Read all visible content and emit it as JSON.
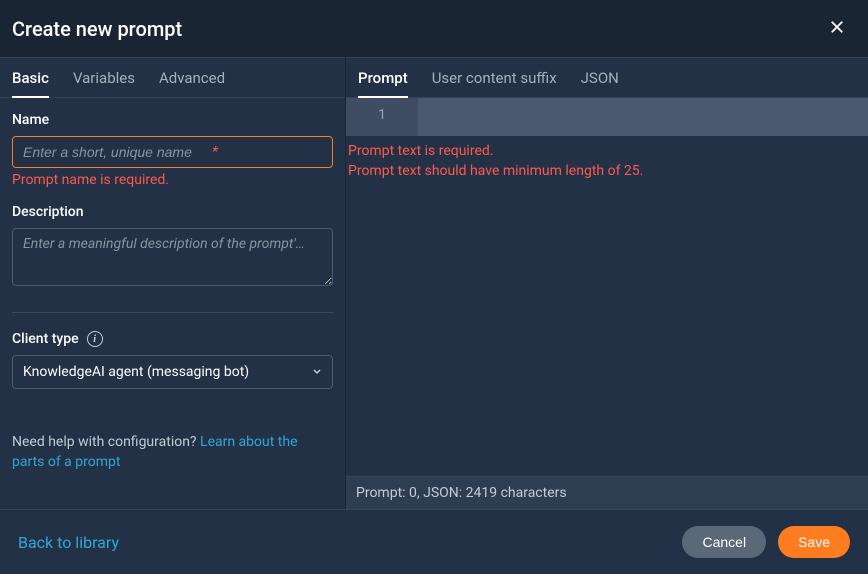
{
  "header": {
    "title": "Create new prompt"
  },
  "leftTabs": [
    {
      "label": "Basic",
      "active": true
    },
    {
      "label": "Variables",
      "active": false
    },
    {
      "label": "Advanced",
      "active": false
    }
  ],
  "rightTabs": [
    {
      "label": "Prompt",
      "active": true
    },
    {
      "label": "User content suffix",
      "active": false
    },
    {
      "label": "JSON",
      "active": false
    }
  ],
  "form": {
    "name": {
      "label": "Name",
      "placeholder": "Enter a short, unique name",
      "asterisk": "*",
      "error": "Prompt name is required."
    },
    "description": {
      "label": "Description",
      "placeholder": "Enter a meaningful description of the prompt'…"
    },
    "clientType": {
      "label": "Client type",
      "selected": "KnowledgeAI agent (messaging bot)"
    },
    "help": {
      "prefix": "Need help with configuration? ",
      "link": "Learn about the parts of a prompt"
    }
  },
  "editor": {
    "lineNumber": "1",
    "errors": [
      "Prompt text is required.",
      "Prompt text should have minimum length of 25."
    ],
    "status": "Prompt: 0, JSON: 2419 characters"
  },
  "footer": {
    "back": "Back to library",
    "cancel": "Cancel",
    "save": "Save"
  }
}
